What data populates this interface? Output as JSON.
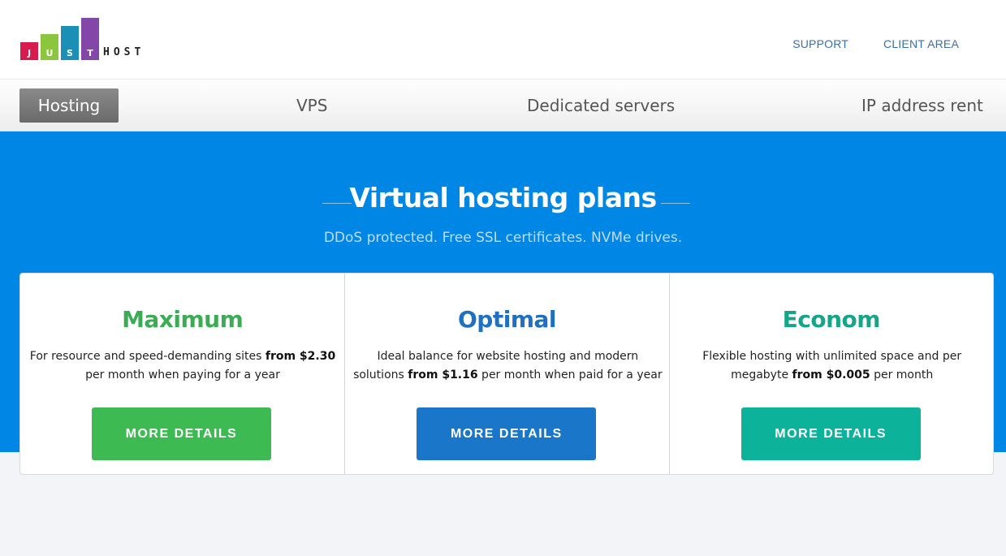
{
  "brand": {
    "logo_letters": [
      "J",
      "U",
      "S",
      "T"
    ],
    "logo_suffix": "HOST",
    "colors": [
      "#d81b4e",
      "#8cc63f",
      "#1b8fb5",
      "#8347a8"
    ]
  },
  "header": {
    "links": [
      "SUPPORT",
      "CLIENT AREA"
    ]
  },
  "nav": {
    "hosting": "Hosting",
    "vps": "VPS",
    "dedicated": "Dedicated servers",
    "ip": "IP address rent"
  },
  "hero": {
    "title": "Virtual hosting plans",
    "subtitle": "DDoS protected. Free SSL certificates. NVMe drives."
  },
  "plans": [
    {
      "name": "Maximum",
      "color": "#3bac54",
      "desc_before": "For resource and speed-demanding sites ",
      "price": "from $2.30",
      "desc_after": " per month when paying for a year",
      "button": "MORE DETAILS",
      "button_color": "#3dbb52"
    },
    {
      "name": "Optimal",
      "color": "#1f70c1",
      "desc_before": "Ideal balance for website hosting and modern solutions ",
      "price": "from $1.16",
      "desc_after": " per month when paid for a year",
      "button": "MORE DETAILS",
      "button_color": "#1a76c8"
    },
    {
      "name": "Econom",
      "color": "#17a589",
      "desc_before": "Flexible hosting with unlimited space and per megabyte ",
      "price": "from $0.005",
      "desc_after": " per month",
      "button": "MORE DETAILS",
      "button_color": "#0db29a"
    }
  ]
}
